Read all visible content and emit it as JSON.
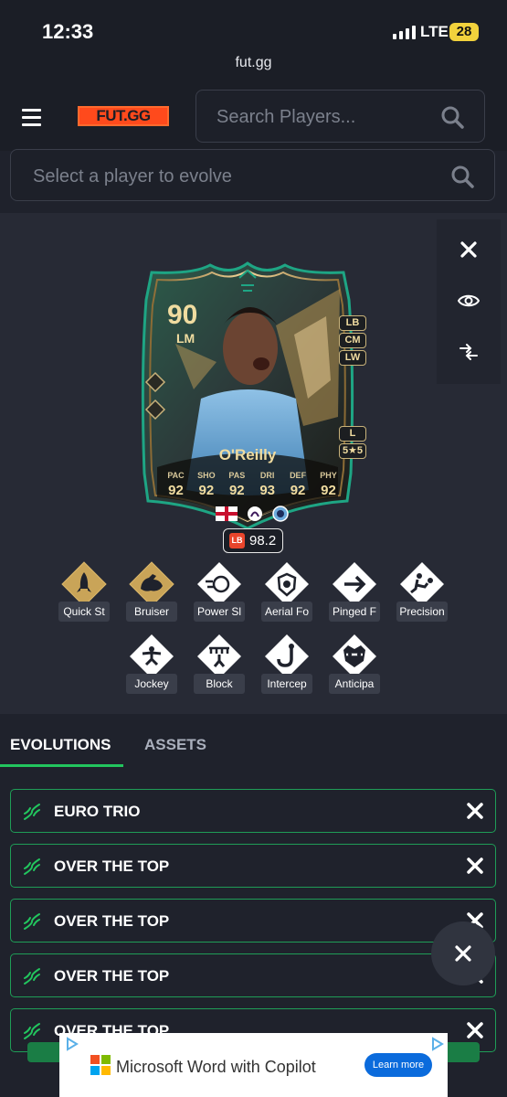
{
  "status_bar": {
    "time": "12:33",
    "network": "LTE",
    "battery": "28"
  },
  "browser": {
    "url": "fut.gg"
  },
  "header": {
    "logo": "FUT.GG",
    "search_placeholder": "Search Players..."
  },
  "evolve_search": {
    "placeholder": "Select a player to evolve"
  },
  "player_card": {
    "rating": "90",
    "position": "LM",
    "alt_positions": [
      "LB",
      "CM",
      "LW"
    ],
    "foot": "L",
    "skill_weak": "5★5",
    "name": "O'Reilly",
    "stats": [
      {
        "label": "PAC",
        "value": "92"
      },
      {
        "label": "SHO",
        "value": "92"
      },
      {
        "label": "PAS",
        "value": "92"
      },
      {
        "label": "DRI",
        "value": "93"
      },
      {
        "label": "DEF",
        "value": "92"
      },
      {
        "label": "PHY",
        "value": "92"
      }
    ],
    "ovr_badge": "LB",
    "ovr_value": "98.2"
  },
  "playstyles": [
    {
      "label": "Quick St",
      "icon": "rocket-icon",
      "plus": true
    },
    {
      "label": "Bruiser",
      "icon": "flexed-arm-icon",
      "plus": true
    },
    {
      "label": "Power Sl",
      "icon": "power-shot-icon",
      "plus": false
    },
    {
      "label": "Aerial Fo",
      "icon": "aerial-shield-icon",
      "plus": false
    },
    {
      "label": "Pinged F",
      "icon": "arrow-pass-icon",
      "plus": false
    },
    {
      "label": "Precision",
      "icon": "precision-kick-icon",
      "plus": false
    },
    {
      "label": "Jockey",
      "icon": "jockey-icon",
      "plus": false
    },
    {
      "label": "Block",
      "icon": "block-icon",
      "plus": false
    },
    {
      "label": "Intercep",
      "icon": "intercept-hook-icon",
      "plus": false
    },
    {
      "label": "Anticipa",
      "icon": "raccoon-icon",
      "plus": false
    }
  ],
  "tabs": [
    {
      "label": "EVOLUTIONS"
    },
    {
      "label": "ASSETS"
    }
  ],
  "evolutions": [
    {
      "name": "EURO TRIO"
    },
    {
      "name": "OVER THE TOP"
    },
    {
      "name": "OVER THE TOP"
    },
    {
      "name": "OVER THE TOP"
    },
    {
      "name": "OVER THE TOP"
    }
  ],
  "ad": {
    "text": "Microsoft Word with Copilot",
    "button": "Learn more"
  },
  "colors": {
    "accent_green": "#22c55e",
    "brand_orange": "#ff4a1c",
    "gold": "#f0dca0"
  }
}
